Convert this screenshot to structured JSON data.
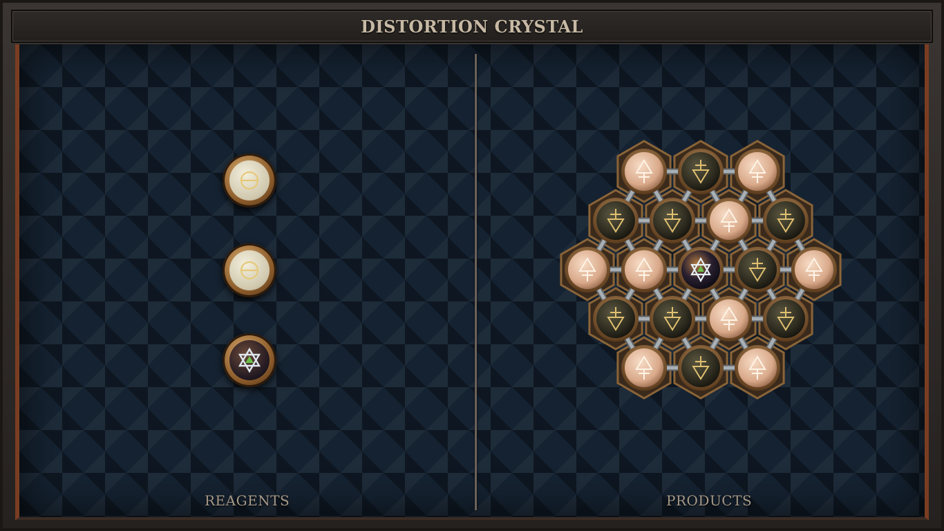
{
  "window": {
    "title": "DISTORTION CRYSTAL"
  },
  "panels": {
    "reagents_label": "REAGENTS",
    "products_label": "PRODUCTS"
  },
  "reagents": [
    {
      "element": "salt-like symbol",
      "icon": "theta-icon",
      "style": "pale"
    },
    {
      "element": "salt-like symbol",
      "icon": "theta-icon",
      "style": "pale"
    },
    {
      "element": "hexagram crystal",
      "icon": "hexagram-icon",
      "style": "dark"
    }
  ],
  "product": {
    "atoms": [
      {
        "kind": "light",
        "icon": "up-triangle-cross-icon"
      },
      {
        "kind": "dark",
        "icon": "down-triangle-cross-icon"
      },
      {
        "kind": "light",
        "icon": "up-triangle-cross-icon"
      },
      {
        "kind": "dark",
        "icon": "down-triangle-cross-icon"
      },
      {
        "kind": "dark",
        "icon": "down-triangle-cross-icon"
      },
      {
        "kind": "light",
        "icon": "up-triangle-cross-icon"
      },
      {
        "kind": "dark",
        "icon": "down-triangle-cross-icon"
      },
      {
        "kind": "light",
        "icon": "up-triangle-cross-icon"
      },
      {
        "kind": "light",
        "icon": "up-triangle-cross-icon"
      },
      {
        "kind": "center",
        "icon": "hexagram-icon"
      },
      {
        "kind": "dark",
        "icon": "down-triangle-cross-icon"
      },
      {
        "kind": "light",
        "icon": "up-triangle-cross-icon"
      },
      {
        "kind": "dark",
        "icon": "down-triangle-cross-icon"
      },
      {
        "kind": "dark",
        "icon": "down-triangle-cross-icon"
      },
      {
        "kind": "light",
        "icon": "up-triangle-cross-icon"
      },
      {
        "kind": "dark",
        "icon": "down-triangle-cross-icon"
      },
      {
        "kind": "light",
        "icon": "up-triangle-cross-icon"
      },
      {
        "kind": "dark",
        "icon": "down-triangle-cross-icon"
      },
      {
        "kind": "light",
        "icon": "up-triangle-cross-icon"
      }
    ]
  },
  "colors": {
    "background": "#152231",
    "light_atom": "#e9c2a8",
    "dark_atom": "#3a3526",
    "glyph_gold": "#e0c070",
    "bond": "#a9b0b5"
  }
}
